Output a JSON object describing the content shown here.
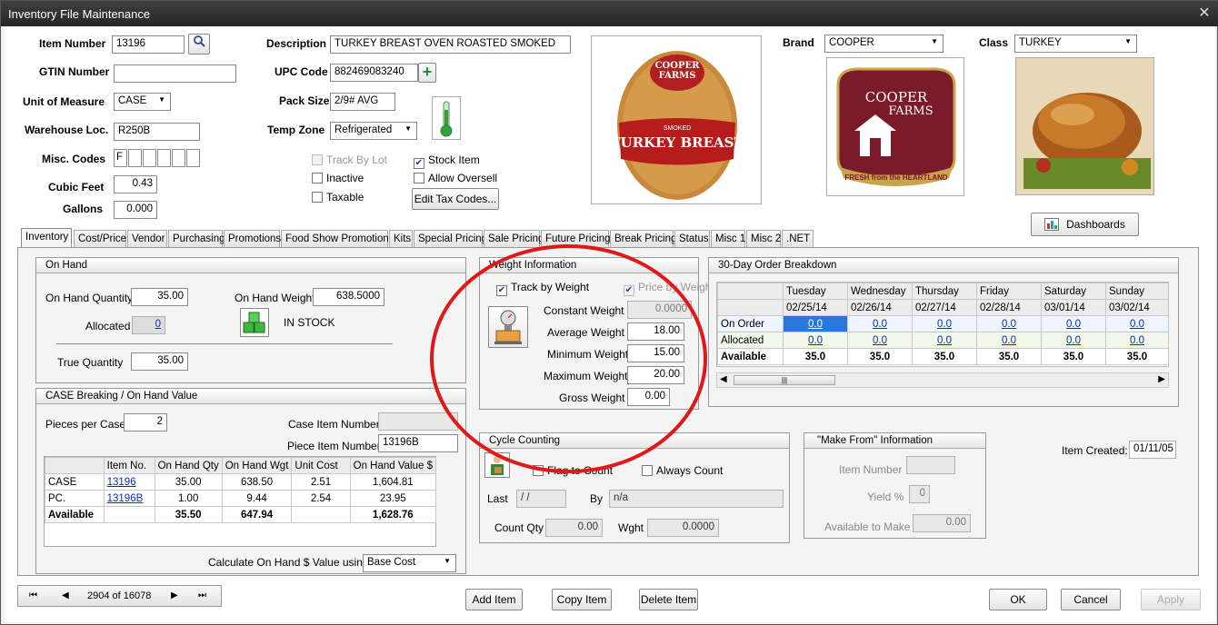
{
  "window": {
    "title": "Inventory File Maintenance",
    "close": "✕"
  },
  "header": {
    "item_number_label": "Item Number",
    "item_number": "13196",
    "gtin_label": "GTIN Number",
    "gtin": "",
    "uom_label": "Unit of Measure",
    "uom": "CASE",
    "warehouse_label": "Warehouse Loc.",
    "warehouse": "R250B",
    "misc_codes_label": "Misc. Codes",
    "misc_codes": [
      "F",
      "",
      "",
      "",
      "",
      ""
    ],
    "cubic_feet_label": "Cubic Feet",
    "cubic_feet": "0.43",
    "gallons_label": "Gallons",
    "gallons": "0.000",
    "description_label": "Description",
    "description": "TURKEY BREAST OVEN ROASTED SMOKED",
    "upc_label": "UPC Code",
    "upc": "882469083240",
    "pack_size_label": "Pack Size",
    "pack_size": "2/9# AVG",
    "temp_zone_label": "Temp Zone",
    "temp_zone": "Refrigerated",
    "brand_label": "Brand",
    "brand": "COOPER",
    "class_label": "Class",
    "class": "TURKEY",
    "checkboxes": {
      "track_by_lot": {
        "label": "Track By Lot",
        "checked": false
      },
      "inactive": {
        "label": "Inactive",
        "checked": false
      },
      "taxable": {
        "label": "Taxable",
        "checked": false
      },
      "stock_item": {
        "label": "Stock Item",
        "checked": true
      },
      "allow_oversell": {
        "label": "Allow Oversell",
        "checked": false
      }
    },
    "edit_tax_codes": "Edit Tax Codes...",
    "dashboards": "Dashboards",
    "product_image_text": {
      "brand_line1": "COOPER",
      "brand_line2": "FARMS",
      "smoked": "SMOKED",
      "name": "TURKEY BREAST"
    },
    "brand_logo_text": {
      "line1": "COOPER",
      "line2": "FARMS",
      "tagline": "FRESH from the HEARTLAND"
    }
  },
  "tabs": [
    "Inventory",
    "Cost/Price",
    "Vendor",
    "Purchasing",
    "Promotions",
    "Food Show Promotions",
    "Kits",
    "Special Pricing",
    "Sale Pricing",
    "Future Pricing",
    "Break Pricing",
    "Status",
    "Misc 1",
    "Misc 2",
    ".NET"
  ],
  "on_hand": {
    "title": "On Hand",
    "qty_label": "On Hand Quantity",
    "qty": "35.00",
    "weight_label": "On Hand Weight",
    "weight": "638.5000",
    "allocated_label": "Allocated",
    "allocated": "0",
    "status": "IN STOCK",
    "true_qty_label": "True Quantity",
    "true_qty": "35.00"
  },
  "case_breaking": {
    "title": "CASE Breaking / On Hand Value",
    "pieces_label": "Pieces per Case",
    "pieces": "2",
    "case_item_label": "Case Item Number",
    "case_item": "",
    "piece_item_label": "Piece Item Number",
    "piece_item": "13196B",
    "columns": [
      "",
      "Item No.",
      "On Hand Qty",
      "On Hand Wgt",
      "Unit Cost",
      "On Hand Value $"
    ],
    "rows": [
      [
        "CASE",
        "13196",
        "35.00",
        "638.50",
        "2.51",
        "1,604.81"
      ],
      [
        "PC.",
        "13196B",
        "1.00",
        "9.44",
        "2.54",
        "23.95"
      ],
      [
        "Available",
        "",
        "35.50",
        "647.94",
        "",
        "1,628.76"
      ]
    ],
    "calc_label": "Calculate On Hand $ Value using:",
    "calc": "Base Cost"
  },
  "weight_info": {
    "title": "Weight Information",
    "track_by_weight": {
      "label": "Track by Weight",
      "checked": true
    },
    "price_by_weight": {
      "label": "Price by Weight",
      "checked": true
    },
    "constant_label": "Constant Weight",
    "constant": "0.0000",
    "average_label": "Average Weight",
    "average": "18.00",
    "minimum_label": "Minimum Weight",
    "minimum": "15.00",
    "maximum_label": "Maximum Weight",
    "maximum": "20.00",
    "gross_label": "Gross Weight",
    "gross": "0.00"
  },
  "order_breakdown": {
    "title": "30-Day Order Breakdown",
    "days": [
      "Tuesday",
      "Wednesday",
      "Thursday",
      "Friday",
      "Saturday",
      "Sunday"
    ],
    "dates": [
      "02/25/14",
      "02/26/14",
      "02/27/14",
      "02/28/14",
      "03/01/14",
      "03/02/14"
    ],
    "rows": [
      {
        "label": "On Order",
        "values": [
          "0.0",
          "0.0",
          "0.0",
          "0.0",
          "0.0",
          "0.0"
        ]
      },
      {
        "label": "Allocated",
        "values": [
          "0.0",
          "0.0",
          "0.0",
          "0.0",
          "0.0",
          "0.0"
        ]
      },
      {
        "label": "Available",
        "values": [
          "35.0",
          "35.0",
          "35.0",
          "35.0",
          "35.0",
          "35.0"
        ]
      }
    ],
    "scroll_thumb": "|||"
  },
  "cycle_counting": {
    "title": "Cycle Counting",
    "flag_to_count": {
      "label": "Flag to Count",
      "checked": false
    },
    "always_count": {
      "label": "Always Count",
      "checked": false
    },
    "last_label": "Last",
    "last": " /  /",
    "by_label": "By",
    "by": "n/a",
    "count_qty_label": "Count Qty",
    "count_qty": "0.00",
    "wght_label": "Wght",
    "wght": "0.0000"
  },
  "make_from": {
    "title": "\"Make From\" Information",
    "item_label": "Item Number",
    "item": "",
    "yield_label": "Yield %",
    "yield": "0",
    "available_label": "Available to Make",
    "available": "0.00"
  },
  "item_created_label": "Item Created:",
  "item_created": "01/11/05",
  "nav": {
    "position": "2904 of 16078",
    "first": "⏮",
    "prev": "◀",
    "next": "▶",
    "last": "⏭"
  },
  "buttons": {
    "add": "Add Item",
    "copy": "Copy Item",
    "delete": "Delete Item",
    "ok": "OK",
    "cancel": "Cancel",
    "apply": "Apply"
  }
}
